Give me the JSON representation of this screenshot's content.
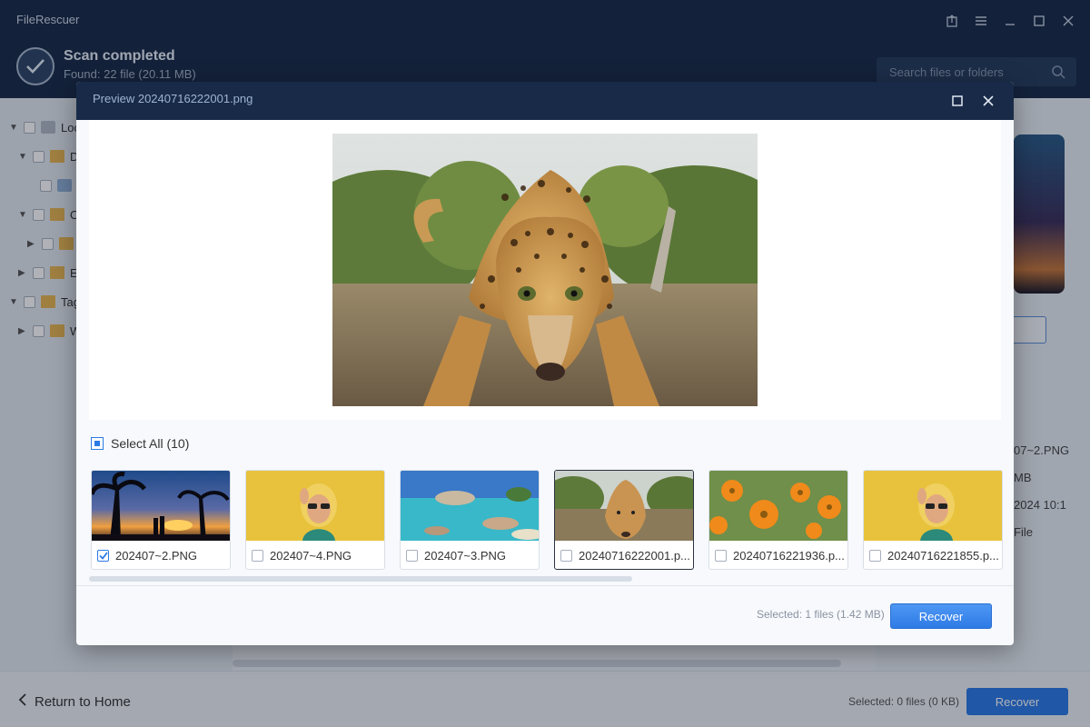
{
  "app": {
    "name": "FileRescuer",
    "scan_title": "Scan completed",
    "scan_summary": "Found: 22 file (20.11 MB)",
    "search_placeholder": "Search files or folders"
  },
  "tree": {
    "items": [
      {
        "label": "Loc",
        "expanded": true
      },
      {
        "label": "D",
        "expanded": true
      },
      {
        "label": "",
        "expanded": false
      },
      {
        "label": "O",
        "expanded": true
      },
      {
        "label": "",
        "expanded": false
      },
      {
        "label": "Ex",
        "expanded": false
      },
      {
        "label": "Tag",
        "expanded": true
      },
      {
        "label": "W",
        "expanded": false
      }
    ]
  },
  "right_panel": {
    "info_lines": [
      "07~2.PNG",
      "MB",
      "2024 10:1",
      "File"
    ]
  },
  "bottom": {
    "return_home": "Return to Home",
    "selected_text": "Selected: 0 files (0 KB)",
    "recover_label": "Recover"
  },
  "modal": {
    "title": "Preview 20240716222001.png",
    "select_all": "Select All (10)",
    "selected_text": "Selected: 1 files (1.42 MB)",
    "recover_label": "Recover",
    "thumbnails": [
      {
        "name": "202407~2.PNG",
        "checked": true,
        "scene": "sunset-palms"
      },
      {
        "name": "202407~4.PNG",
        "checked": false,
        "scene": "woman-yellow-wall"
      },
      {
        "name": "202407~3.PNG",
        "checked": false,
        "scene": "tropical-beach"
      },
      {
        "name": "20240716222001.p...",
        "checked": false,
        "scene": "leopard"
      },
      {
        "name": "20240716221936.p...",
        "checked": false,
        "scene": "orange-flowers"
      },
      {
        "name": "20240716221855.p...",
        "checked": false,
        "scene": "woman-yellow-wall"
      }
    ]
  },
  "colors": {
    "titlebar": "#182a47",
    "accent": "#2c7ae6"
  }
}
